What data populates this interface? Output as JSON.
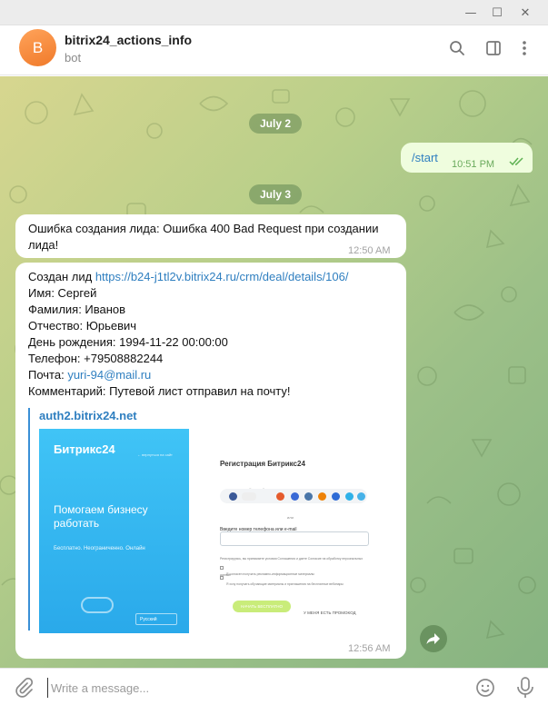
{
  "chat": {
    "title": "bitrix24_actions_info",
    "subtitle": "bot",
    "avatar_letter": "B"
  },
  "messages": {
    "date1": "July 2",
    "start_text": "/start",
    "start_time": "10:51 PM",
    "date2": "July 3",
    "error_text": "Ошибка создания лида: Ошибка 400 Bad Request при создании лида!",
    "error_time": "12:50 AM",
    "lead": {
      "created_prefix": "Создан лид ",
      "created_link": "https://b24-j1tl2v.bitrix24.ru/crm/deal/details/106/",
      "name_line": "Имя: Сергей",
      "surname_line": "Фамилия: Иванов",
      "patronymic_line": "Отчество: Юрьевич",
      "birthday_line": "День рождения: 1994-11-22 00:00:00",
      "phone_line": "Телефон: +79508882244",
      "email_prefix": "Почта: ",
      "email_link": "yuri-94@mail.ru",
      "comment_line": "Комментарий: Путевой лист отправил на почту!",
      "preview_site": "auth2.bitrix24.net",
      "time": "12:56 AM"
    }
  },
  "preview": {
    "brand": "Битрикс24",
    "brand_note": "← вернуться на сайт",
    "slogan": "Помогаем бизнесу работать",
    "tagline": "Бесплатно. Неограниченно. Онлайн",
    "lang": "Русский",
    "reg_title": "Регистрация Битрикс24",
    "reg_hint": "Используйте для регистрации ваш аккаунт в соцсети",
    "reg_or": "или",
    "reg_label": "Введите номер телефона или e-mail",
    "agree_text": "Регистрируясь, вы принимаете условия Соглашения и даете Согласие на обработку персональных данных",
    "check1": "Я согласен получать рекламно-информационные материалы",
    "check2": "Я хочу получать обучающие материалы и приглашения на бесплатные вебинары",
    "button": "НАЧАТЬ БЕСПЛАТНО",
    "promo": "У МЕНЯ ЕСТЬ ПРОМОКОД"
  },
  "composer": {
    "placeholder": "Write a message..."
  },
  "colors": {
    "accent": "#2f7fc0",
    "outgoing_bubble": "#effdde",
    "avatar": "#f58a3a"
  }
}
